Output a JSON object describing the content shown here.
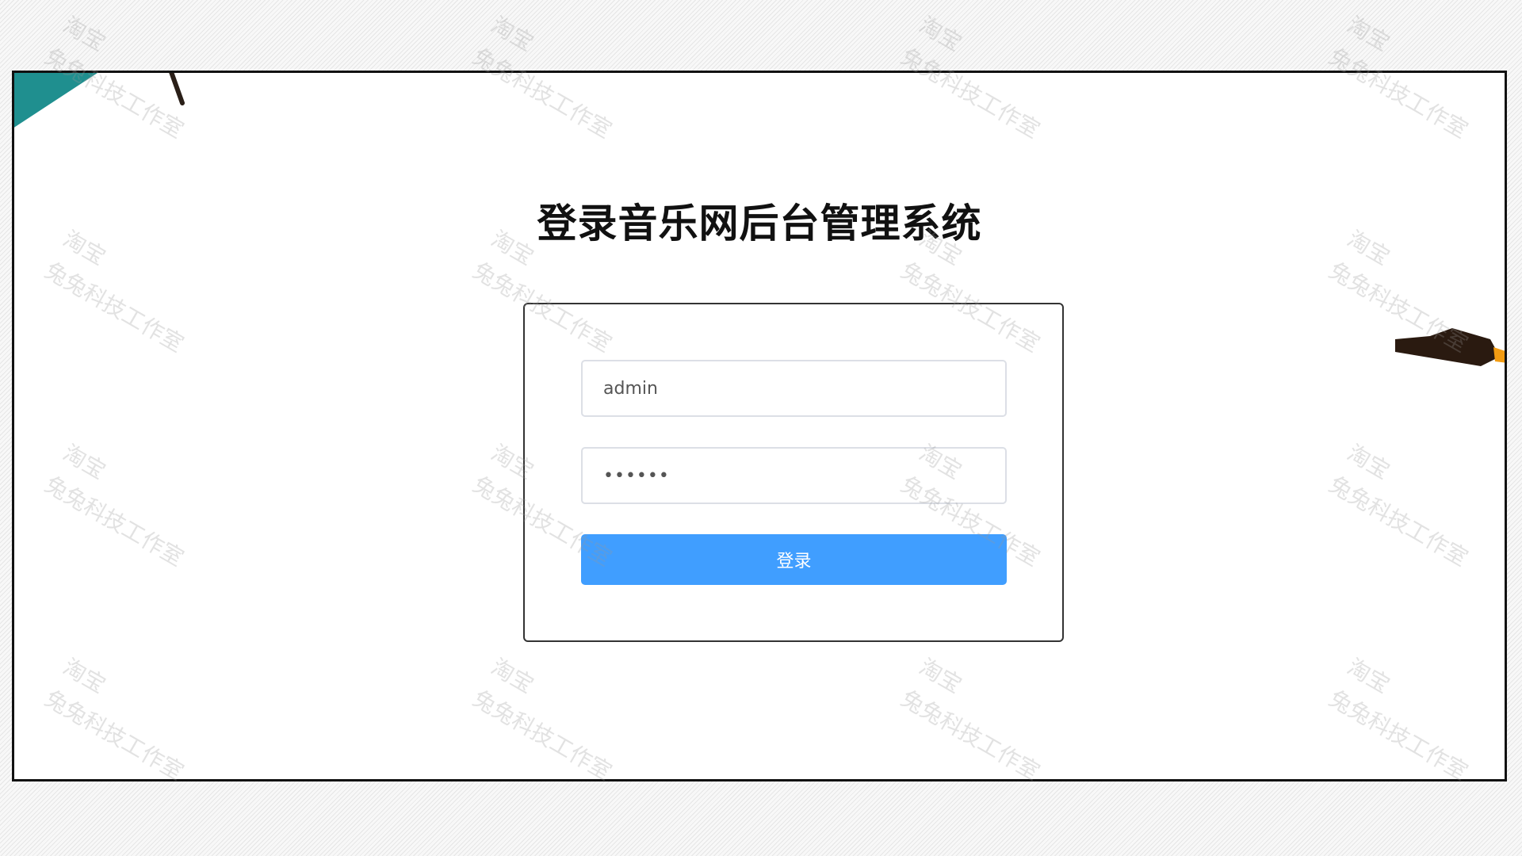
{
  "page": {
    "title": "登录音乐网后台管理系统"
  },
  "form": {
    "username_value": "admin",
    "password_value": "••••••",
    "submit_label": "登录"
  },
  "watermark": {
    "shop": "淘宝",
    "studio": "兔兔科技工作室"
  },
  "colors": {
    "accent": "#409eff",
    "corner_decoration": "#1f8f8f",
    "pen_decoration": "#2a1a10",
    "pen_tip": "#f39c12"
  }
}
